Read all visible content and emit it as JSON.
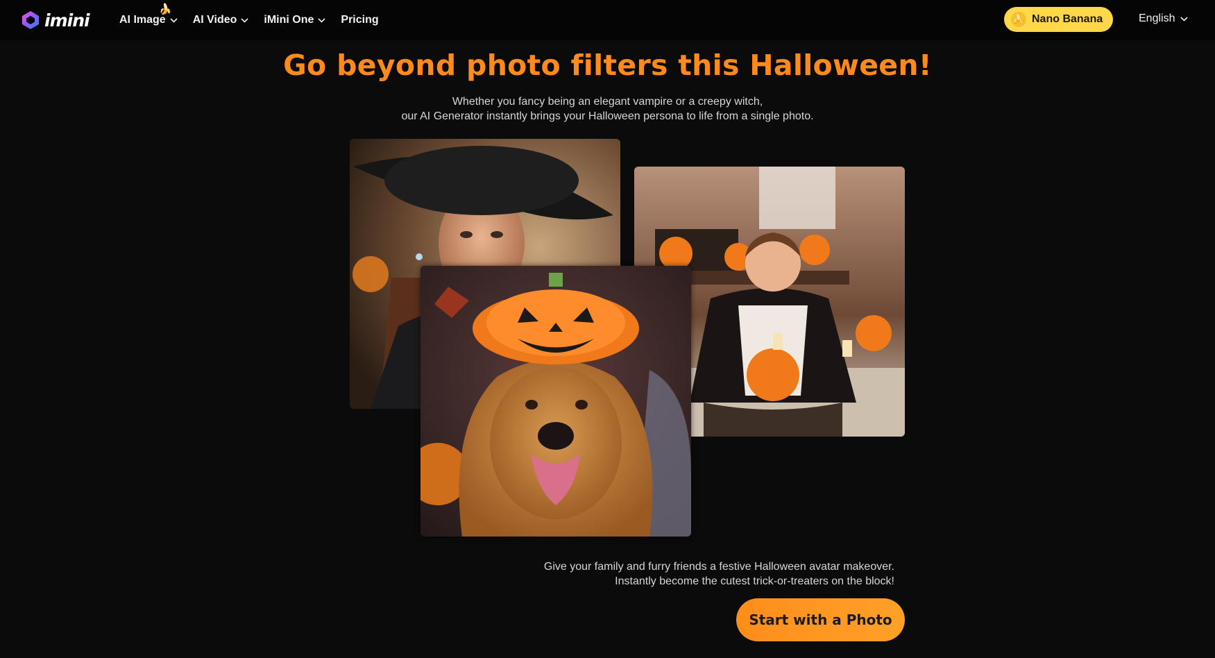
{
  "header": {
    "logo_text": "imini",
    "nav": [
      {
        "label": "AI Image",
        "icon": "chevron-down-icon"
      },
      {
        "label": "AI Video",
        "icon": "chevron-down-icon"
      },
      {
        "label": "iMini One",
        "icon": "chevron-down-icon"
      },
      {
        "label": "Pricing"
      }
    ],
    "nano_label": "Nano Banana",
    "language": "English"
  },
  "hero": {
    "title": "Go beyond photo filters this Halloween!",
    "subtitle_line1": "Whether you fancy being an elegant vampire or a creepy witch,",
    "subtitle_line2": "our AI Generator instantly brings your Halloween persona to life from a single photo."
  },
  "gallery": {
    "photos": [
      "witch-portrait",
      "golden-retriever-pumpkin-hat",
      "boy-vampire-costume"
    ]
  },
  "caption": {
    "line1": "Give your family and furry friends a festive Halloween avatar makeover.",
    "line2": "Instantly become the cutest trick-or-treaters on the block!"
  },
  "cta": {
    "label": "Start with a Photo"
  },
  "colors": {
    "accent": "#ff8a1c",
    "background": "#0b0b0b",
    "nano_badge": "#ffd84a"
  }
}
